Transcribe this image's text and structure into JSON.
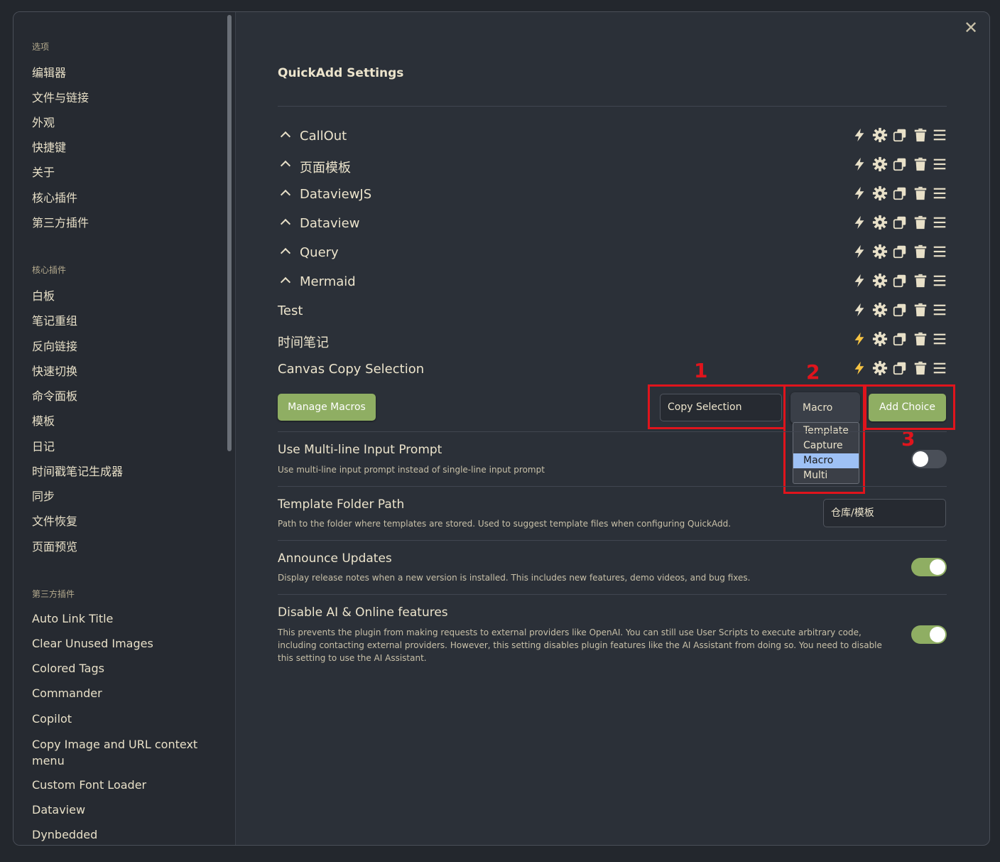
{
  "sidebar": {
    "options_heading": "选项",
    "options": [
      "编辑器",
      "文件与链接",
      "外观",
      "快捷键",
      "关于",
      "核心插件",
      "第三方插件"
    ],
    "core_heading": "核心插件",
    "core": [
      "白板",
      "笔记重组",
      "反向链接",
      "快速切换",
      "命令面板",
      "模板",
      "日记",
      "时间戳笔记生成器",
      "同步",
      "文件恢复",
      "页面预览"
    ],
    "third_heading": "第三方插件",
    "third": [
      "Auto Link Title",
      "Clear Unused Images",
      "Colored Tags",
      "Commander",
      "Copilot",
      "Copy Image and URL context menu",
      "Custom Font Loader",
      "Dataview",
      "Dynbedded"
    ]
  },
  "title": "QuickAdd Settings",
  "choices": [
    {
      "name": "CallOut",
      "collapsible": true
    },
    {
      "name": "页面模板",
      "collapsible": true
    },
    {
      "name": "DataviewJS",
      "collapsible": true
    },
    {
      "name": "Dataview",
      "collapsible": true
    },
    {
      "name": "Query",
      "collapsible": true
    },
    {
      "name": "Mermaid",
      "collapsible": true
    },
    {
      "name": "Test",
      "collapsible": false
    },
    {
      "name": "时间笔记",
      "collapsible": false
    },
    {
      "name": "Canvas Copy Selection",
      "collapsible": false
    }
  ],
  "icons": [
    "lightning-icon",
    "gear-icon",
    "duplicate-icon",
    "trash-icon",
    "drag-handle-icon"
  ],
  "colors": {
    "accent": "#8fae63",
    "highlight": "#f6c343",
    "annotation": "#e0141c"
  },
  "manage_macros": "Manage Macros",
  "choice_name_value": "Copy Selection",
  "type_select": {
    "value": "Macro",
    "options": [
      "Template",
      "Capture",
      "Macro",
      "Multi"
    ]
  },
  "add_choice": "Add Choice",
  "annotations": [
    "1",
    "2",
    "3"
  ],
  "settings": [
    {
      "name": "Use Multi-line Input Prompt",
      "desc": "Use multi-line input prompt instead of single-line input prompt",
      "enabled": false
    },
    {
      "name": "Template Folder Path",
      "desc": "Path to the folder where templates are stored. Used to suggest template files when configuring QuickAdd.",
      "value": "仓库/模板"
    },
    {
      "name": "Announce Updates",
      "desc": "Display release notes when a new version is installed. This includes new features, demo videos, and bug fixes.",
      "enabled": true
    },
    {
      "name": "Disable AI & Online features",
      "desc": "This prevents the plugin from making requests to external providers like OpenAI. You can still use User Scripts to execute arbitrary code, including contacting external providers. However, this setting disables plugin features like the AI Assistant from doing so. You need to disable this setting to use the AI Assistant.",
      "enabled": true
    }
  ]
}
